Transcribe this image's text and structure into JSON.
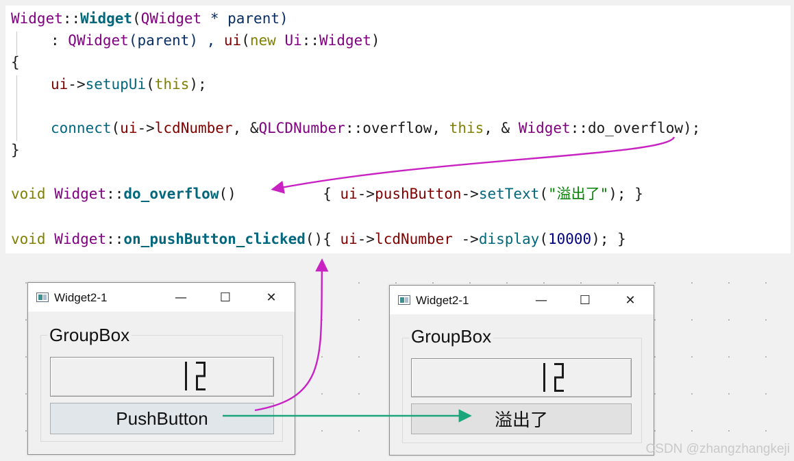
{
  "code": {
    "l1": {
      "cls1": "Widget",
      "sep1": "::",
      "ctor": "Widget",
      "p1": "(",
      "type1": "QWidget",
      "rest1": " * parent)"
    },
    "l2": {
      "pre": ": ",
      "base": "QWidget",
      "rest": "(parent) , ",
      "ui": "ui",
      "p2": "(",
      "new": "new",
      "sp": " ",
      "uicls": "Ui",
      "sep": "::",
      "wid": "Widget",
      "close": ")"
    },
    "l3": "{",
    "l4": {
      "ui": "ui",
      "arrow": "->",
      "fn": "setupUi",
      "p": "(",
      "this": "this",
      "rest": ");"
    },
    "l5": {
      "fn": "connect",
      "p": "(",
      "ui": "ui",
      "arrow": "->",
      "lcd": "lcdNumber",
      "comma": ", &",
      "cls": "QLCDNumber",
      "sep": "::",
      "sig": "overflow",
      "comma2": ", ",
      "this": "this",
      "comma3": ", & ",
      "wcls": "Widget",
      "sep2": "::",
      "slot": "do_overflow",
      "end": ");"
    },
    "l6": "}",
    "l7": {
      "void": "void",
      "sp": " ",
      "cls": "Widget",
      "sep": "::",
      "fn": "do_overflow",
      "paren": "()",
      "gap": "          { ",
      "ui": "ui",
      "arrow": "->",
      "btn": "pushButton",
      "arrow2": "->",
      "set": "setText",
      "p": "(",
      "str": "\"溢出了\"",
      "end": "); }"
    },
    "l8": {
      "void": "void",
      "sp": " ",
      "cls": "Widget",
      "sep": "::",
      "fn": "on_pushButton_clicked",
      "paren": "(){ ",
      "ui": "ui",
      "arrow": "->",
      "lcd": "lcdNumber",
      "arrow2": " ->",
      "disp": "display",
      "p": "(",
      "num": "10000",
      "end": "); }"
    }
  },
  "window_left": {
    "title": "Widget2-1",
    "minimize_glyph": "—",
    "maximize_glyph": "☐",
    "close_glyph": "✕",
    "groupbox_title": "GroupBox",
    "lcd_value": 12,
    "button_label": "PushButton"
  },
  "window_right": {
    "title": "Widget2-1",
    "minimize_glyph": "—",
    "maximize_glyph": "☐",
    "close_glyph": "✕",
    "groupbox_title": "GroupBox",
    "lcd_value": 12,
    "button_label": "溢出了"
  },
  "colors": {
    "signal_arrow": "#c822c2",
    "click_arrow": "#1aa67a",
    "lcd_segment": "#1a1a1a"
  },
  "watermark": "CSDN @zhangzhangkeji"
}
